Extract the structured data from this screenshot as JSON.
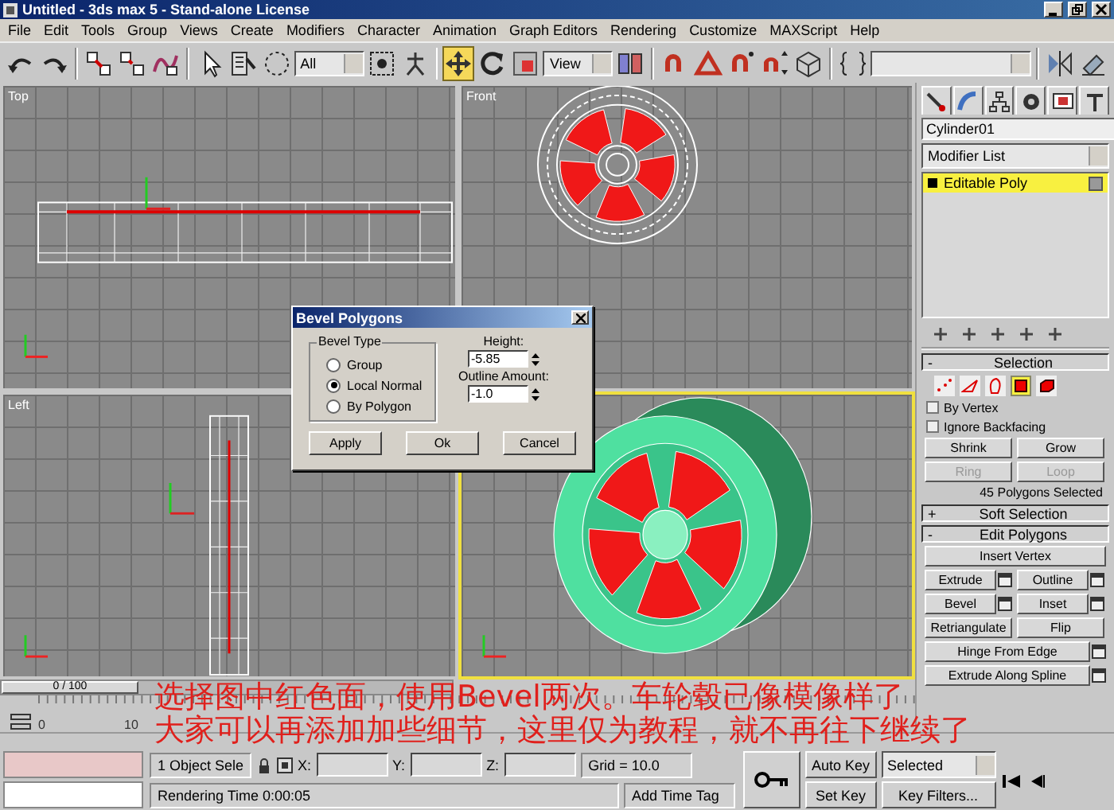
{
  "window": {
    "title": "Untitled - 3ds max 5 - Stand-alone License"
  },
  "menu": [
    "File",
    "Edit",
    "Tools",
    "Group",
    "Views",
    "Create",
    "Modifiers",
    "Character",
    "Animation",
    "Graph Editors",
    "Rendering",
    "Customize",
    "MAXScript",
    "Help"
  ],
  "toolbar": [
    {
      "kind": "tool",
      "selected": false
    },
    {
      "kind": "tool",
      "selected": false
    },
    {
      "kind": "sep"
    },
    {
      "kind": "tool",
      "selected": false
    },
    {
      "kind": "tool",
      "selected": false
    },
    {
      "kind": "tool",
      "selected": false
    },
    {
      "kind": "sep"
    },
    {
      "kind": "tool",
      "selected": false
    },
    {
      "kind": "tool",
      "selected": false
    },
    {
      "kind": "tool",
      "selected": false
    },
    {
      "kind": "dropdown",
      "value": "All"
    },
    {
      "kind": "tool",
      "selected": false
    },
    {
      "kind": "tool",
      "selected": false
    },
    {
      "kind": "sep"
    },
    {
      "kind": "tool",
      "selected": true
    },
    {
      "kind": "tool",
      "selected": false
    },
    {
      "kind": "tool",
      "selected": false
    },
    {
      "kind": "dropdown",
      "value": "View"
    },
    {
      "kind": "tool",
      "selected": false
    },
    {
      "kind": "sep"
    },
    {
      "kind": "tool",
      "selected": false
    },
    {
      "kind": "tool",
      "selected": false
    },
    {
      "kind": "tool",
      "selected": false
    },
    {
      "kind": "tool",
      "selected": false
    },
    {
      "kind": "tool",
      "selected": false
    },
    {
      "kind": "sep"
    },
    {
      "kind": "tool",
      "selected": false
    },
    {
      "kind": "dropdown"
    },
    {
      "kind": "sep"
    },
    {
      "kind": "tool",
      "selected": false
    },
    {
      "kind": "tool",
      "selected": false
    }
  ],
  "viewports": [
    {
      "kind": "top",
      "label": "Top",
      "active": false
    },
    {
      "kind": "front",
      "label": "Front",
      "active": false
    },
    {
      "kind": "left",
      "label": "Left",
      "active": false
    },
    {
      "kind": "perspective",
      "active": true
    }
  ],
  "dialog": {
    "title": "Bevel Polygons",
    "group_label": "Bevel Type",
    "options": [
      {
        "label": "Group",
        "selected": false
      },
      {
        "label": "Local Normal",
        "selected": true
      },
      {
        "label": "By Polygon",
        "selected": false
      }
    ],
    "height_label": "Height:",
    "height_value": "-5.85",
    "outline_label": "Outline Amount:",
    "outline_value": "-1.0",
    "buttons": [
      "Apply",
      "Ok",
      "Cancel"
    ]
  },
  "command_panel": {
    "object_name": "Cylinder01",
    "modifier_list": "Modifier List",
    "stack": [
      {
        "label": "Editable Poly",
        "selected": true
      }
    ],
    "selection": {
      "toggle": "-",
      "title": "Selection",
      "subobjects": [
        {
          "selected": false
        },
        {
          "selected": false
        },
        {
          "selected": false
        },
        {
          "selected": true
        },
        {
          "selected": false
        }
      ],
      "checks": [
        {
          "label": "By Vertex",
          "checked": false
        },
        {
          "label": "Ignore Backfacing",
          "checked": false
        }
      ],
      "buttons": [
        {
          "label": "Shrink",
          "disabled": false
        },
        {
          "label": "Grow",
          "disabled": false
        },
        {
          "label": "Ring",
          "disabled": true
        },
        {
          "label": "Loop",
          "disabled": true
        }
      ],
      "status": "45 Polygons Selected"
    },
    "rollouts": [
      {
        "toggle": "+",
        "title": "Soft Selection"
      },
      {
        "toggle": "-",
        "title": "Edit Polygons"
      }
    ],
    "edit_polygons": [
      {
        "label": "Insert Vertex",
        "kind": "wide",
        "settings": false
      },
      {
        "label": "Extrude",
        "kind": "half",
        "settings": true
      },
      {
        "label": "Outline",
        "kind": "half",
        "settings": true
      },
      {
        "label": "Bevel",
        "kind": "half",
        "settings": true
      },
      {
        "label": "Inset",
        "kind": "half",
        "settings": true
      },
      {
        "label": "Retriangulate",
        "kind": "half",
        "settings": false
      },
      {
        "label": "Flip",
        "kind": "half",
        "settings": false
      },
      {
        "label": "Hinge From Edge",
        "kind": "wide",
        "settings": true
      },
      {
        "label": "Extrude Along Spline",
        "kind": "wide",
        "settings": true
      }
    ]
  },
  "timeline": {
    "position": "0 / 100",
    "ticks": [
      "0",
      "10"
    ]
  },
  "status_bar": {
    "selection": "1 Object Sele",
    "x_label": "X:",
    "y_label": "Y:",
    "z_label": "Z:",
    "prompt": "Rendering Time  0:00:05",
    "grid": "Grid = 10.0",
    "time_tag": "Add Time Tag",
    "auto_key": "Auto Key",
    "set_key": "Set Key",
    "key_mode": "Selected",
    "key_filters": "Key Filters..."
  },
  "caption": [
    "选择图中红色面，使用Bevel两次。车轮毂已像模像样了",
    "大家可以再添加加些细节，这里仅为教程，就不再往下继续了"
  ]
}
